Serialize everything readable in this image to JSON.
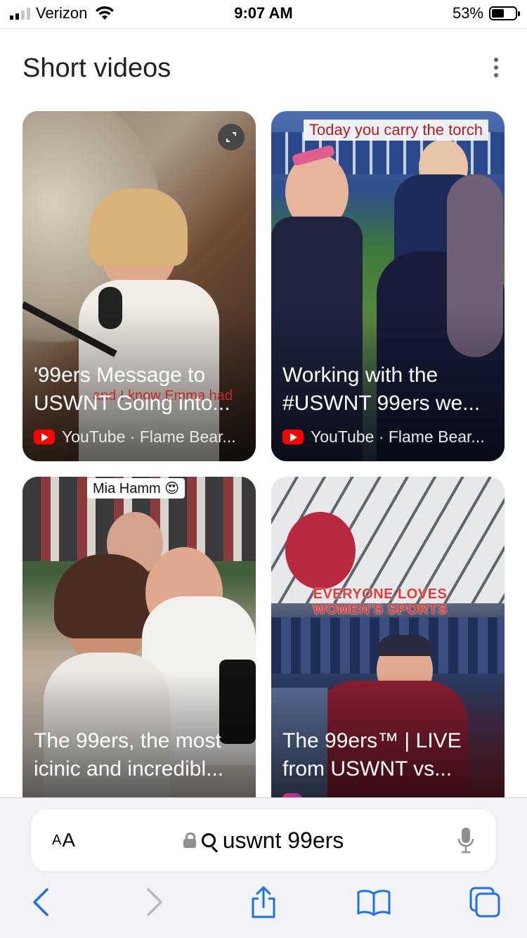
{
  "status_bar": {
    "carrier": "Verizon",
    "time": "9:07 AM",
    "battery": "53%",
    "battery_level": 0.53,
    "signal_bars": 4,
    "signal_strong_bars": 2
  },
  "section": {
    "title": "Short videos"
  },
  "cards": [
    {
      "title": "'99ers Message to USWNT Going into...",
      "source": "YouTube · Flame Bear...",
      "source_icon": "youtube-icon",
      "overlay_caption": "and I know Emma had"
    },
    {
      "title": "Working with the #USWNT 99ers we...",
      "source": "YouTube · Flame Bear...",
      "source_icon": "youtube-icon",
      "overlay_caption": "Today you carry the torch"
    },
    {
      "title": "The 99ers, the most icinic and incredibl...",
      "source": "",
      "source_icon": "",
      "overlay_caption": "Mia Hamm 😍"
    },
    {
      "title": "The 99ers™ | LIVE from USWNT vs...",
      "source": "",
      "source_icon": "instagram-icon",
      "overlay_caption": "EVERYONE LOVES WOMEN'S SPORTS"
    }
  ],
  "browser": {
    "text_size_label_small": "A",
    "text_size_label_large": "A",
    "url": "uswnt 99ers"
  },
  "colors": {
    "accent": "#1a73e8",
    "youtube_red": "#ff0000",
    "toolbar_bg": "#f2f2f7"
  }
}
